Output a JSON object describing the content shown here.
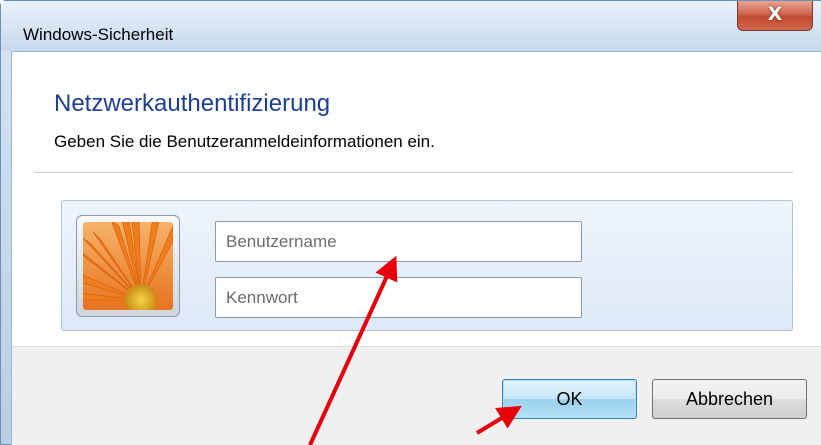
{
  "window": {
    "title": "Windows-Sicherheit",
    "close_glyph": "X"
  },
  "dialog": {
    "heading": "Netzwerkauthentifizierung",
    "subheading": "Geben Sie die Benutzeranmeldeinformationen ein."
  },
  "credentials": {
    "avatar_icon": "user-avatar-flower-icon",
    "username_placeholder": "Benutzername",
    "password_placeholder": "Kennwort"
  },
  "buttons": {
    "ok_label": "OK",
    "cancel_label": "Abbrechen"
  },
  "annotations": {
    "arrow_color": "#e8000b"
  }
}
